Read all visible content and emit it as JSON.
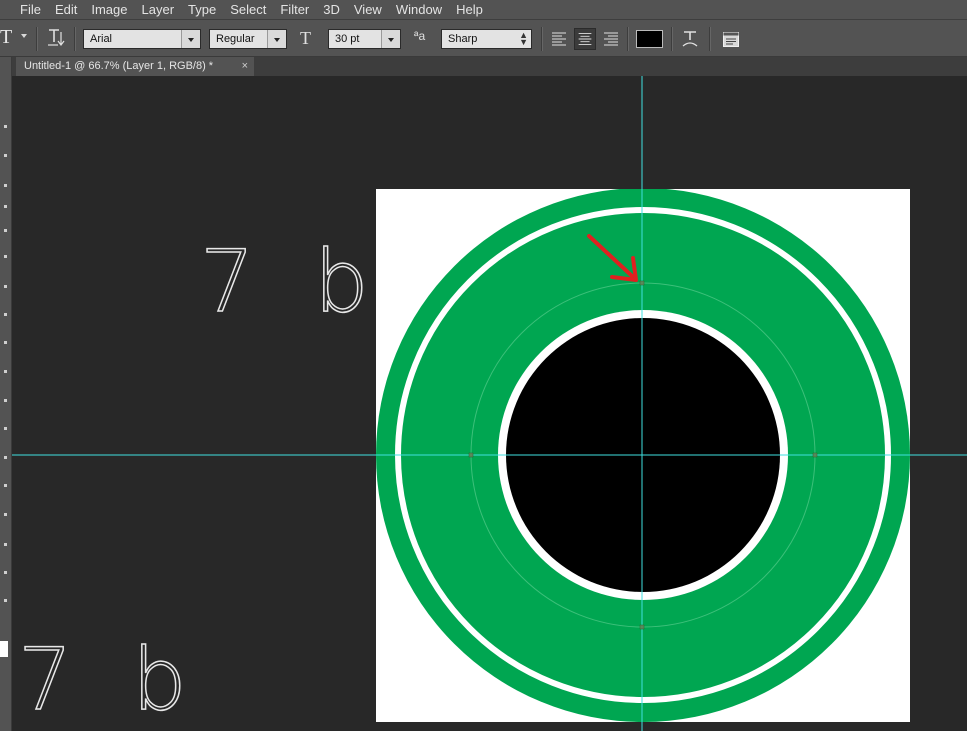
{
  "menu": [
    "File",
    "Edit",
    "Image",
    "Layer",
    "Type",
    "Select",
    "Filter",
    "3D",
    "View",
    "Window",
    "Help"
  ],
  "options": {
    "tool_glyph": "T",
    "font_family": "Arial",
    "font_style": "Regular",
    "font_size": "30 pt",
    "aa_icon_text": "ªa",
    "antialias": "Sharp",
    "text_color": "#000000",
    "size_glyph": "T"
  },
  "document": {
    "tab_title": "Untitled-1 @ 66.7% (Layer 1, RGB/8) *",
    "close_glyph": "×"
  },
  "canvas": {
    "floating_text": "7 b",
    "ring_color": "#00a651",
    "center_color": "#000000",
    "guide_color": "#3fe0e0",
    "arrow_color": "#e02020"
  },
  "icons": [
    "horizontal-type-tool-icon",
    "text-orientation-icon",
    "font-size-icon",
    "antialias-icon",
    "align-left-icon",
    "align-center-icon",
    "align-right-icon",
    "text-color-swatch",
    "warp-text-icon",
    "character-panel-icon",
    "close-icon",
    "red-arrow-annotation"
  ]
}
